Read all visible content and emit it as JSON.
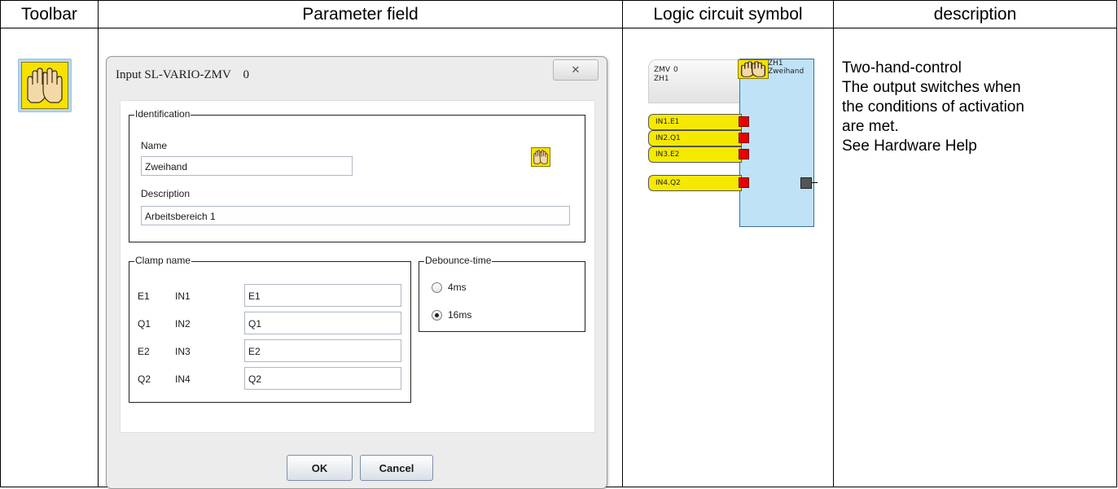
{
  "table": {
    "headers": [
      "Toolbar",
      "Parameter field",
      "Logic circuit symbol",
      "description"
    ]
  },
  "toolbar": {
    "icon": "two-hand-control-icon"
  },
  "dialog": {
    "title": "Input SL-VARIO-ZMV    0",
    "close_glyph": "✕",
    "identification": {
      "legend": "Identification",
      "name_label": "Name",
      "name_value": "Zweihand",
      "description_label": "Description",
      "description_value": "Arbeitsbereich 1"
    },
    "clamp": {
      "legend": "Clamp name",
      "rows": [
        {
          "terminal": "E1",
          "input": "IN1",
          "value": "E1"
        },
        {
          "terminal": "Q1",
          "input": "IN2",
          "value": "Q1"
        },
        {
          "terminal": "E2",
          "input": "IN3",
          "value": "E2"
        },
        {
          "terminal": "Q2",
          "input": "IN4",
          "value": "Q2"
        }
      ]
    },
    "debounce": {
      "legend": "Debounce-time",
      "options": [
        {
          "label": "4ms",
          "selected": false
        },
        {
          "label": "16ms",
          "selected": true
        }
      ]
    },
    "ok_label": "OK",
    "cancel_label": "Cancel"
  },
  "symbol": {
    "head_type": "ZMV",
    "head_num": "0",
    "head_name": "ZH1",
    "title_line1": "ZH1",
    "title_line2": "Zweihand",
    "pins": [
      "IN1.E1",
      "IN2.Q1",
      "IN3.E2",
      "IN4.Q2"
    ]
  },
  "description": {
    "lines": [
      "Two-hand-control",
      "The output switches when",
      "the conditions of activation",
      "are met.",
      "See Hardware Help"
    ]
  }
}
